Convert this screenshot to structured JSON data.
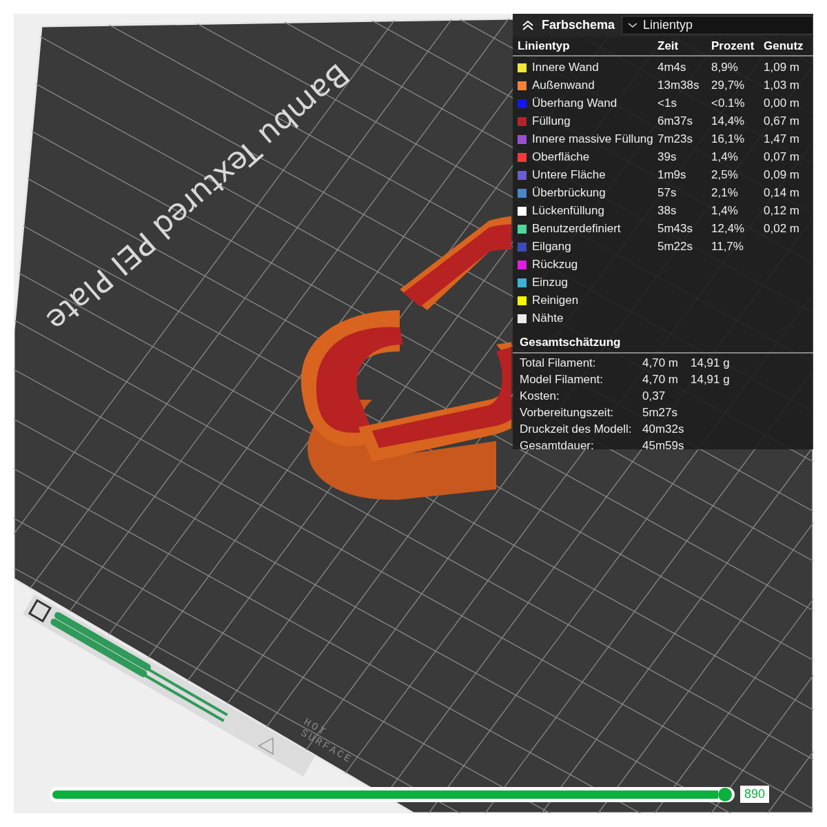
{
  "viewport": {
    "plate_label": "Bambu Textured PEI Plate",
    "plate_warning": [
      "HOT",
      "SURFACE"
    ]
  },
  "legend": {
    "title": "Farbschema",
    "view_select": {
      "value": "Linientyp"
    },
    "columns": [
      "Linientyp",
      "Zeit",
      "Prozent",
      "Genutz"
    ],
    "rows": [
      {
        "name": "Innere Wand",
        "time": "4m4s",
        "percent": "8,9%",
        "used": "1,09 m",
        "color": "#f2e63a"
      },
      {
        "name": "Außenwand",
        "time": "13m38s",
        "percent": "29,7%",
        "used": "1,03 m",
        "color": "#f5823a"
      },
      {
        "name": "Überhang Wand",
        "time": "<1s",
        "percent": "<0.1%",
        "used": "0,00 m",
        "color": "#1414f5"
      },
      {
        "name": "Füllung",
        "time": "6m37s",
        "percent": "14,4%",
        "used": "0,67 m",
        "color": "#b3232a"
      },
      {
        "name": "Innere massive Füllung",
        "time": "7m23s",
        "percent": "16,1%",
        "used": "1,47 m",
        "color": "#9a4fd6"
      },
      {
        "name": "Oberfläche",
        "time": "39s",
        "percent": "1,4%",
        "used": "0,07 m",
        "color": "#f23a3a"
      },
      {
        "name": "Untere Fläche",
        "time": "1m9s",
        "percent": "2,5%",
        "used": "0,09 m",
        "color": "#6b5bd6"
      },
      {
        "name": "Überbrückung",
        "time": "57s",
        "percent": "2,1%",
        "used": "0,14 m",
        "color": "#4a86c8"
      },
      {
        "name": "Lückenfüllung",
        "time": "38s",
        "percent": "1,4%",
        "used": "0,12 m",
        "color": "#ffffff"
      },
      {
        "name": "Benutzerdefiniert",
        "time": "5m43s",
        "percent": "12,4%",
        "used": "0,02 m",
        "color": "#4fd69a"
      },
      {
        "name": "Eilgang",
        "time": "5m22s",
        "percent": "11,7%",
        "color": "#3a4cb8"
      },
      {
        "name": "Rückzug",
        "color": "#e01ee0"
      },
      {
        "name": "Einzug",
        "color": "#3ab4d6"
      },
      {
        "name": "Reinigen",
        "color": "#f5f500"
      },
      {
        "name": "Nähte",
        "color": "#ececec"
      }
    ]
  },
  "summary": {
    "title": "Gesamtschätzung",
    "rows": [
      {
        "label": "Total Filament:",
        "values": [
          "4,70 m",
          "14,91 g"
        ]
      },
      {
        "label": "Model Filament:",
        "values": [
          "4,70 m",
          "14,91 g"
        ]
      },
      {
        "label": "Kosten:",
        "values": [
          "0,37"
        ]
      },
      {
        "label": "Vorbereitungszeit:",
        "values": [
          "5m27s"
        ]
      },
      {
        "label": "Druckzeit des Modell:",
        "values": [
          "40m32s"
        ]
      },
      {
        "label": "Gesamtdauer:",
        "values": [
          "45m59s"
        ]
      }
    ]
  },
  "layer_slider": {
    "level": 1,
    "value": "890"
  }
}
